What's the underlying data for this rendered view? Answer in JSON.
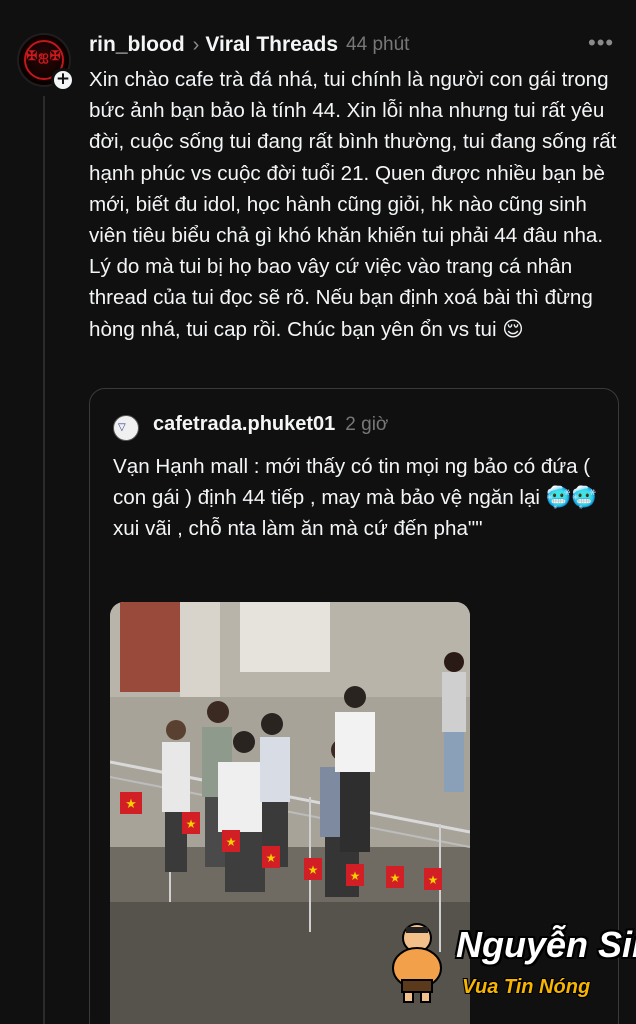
{
  "post": {
    "username": "rin_blood",
    "community": "Viral Threads",
    "time": "44 phút",
    "more_icon": "more-icon",
    "body": "Xin chào cafe trà đá nhá, tui chính là người con gái trong bức ảnh bạn bảo là tính 44. Xin lỗi nha nhưng tui rất yêu đời, cuộc sống tui đang rất bình thường, tui đang sống rất hạnh phúc vs cuộc đời tuổi 21. Quen được nhiều bạn bè mới, biết đu idol, học hành cũng giỏi, hk nào cũng sinh viên tiêu biểu chả gì khó khăn khiến tui phải 44 đâu nha. Lý do mà tui bị họ bao vây cứ việc vào trang cá nhân thread của tui đọc sẽ rõ. Nếu bạn định xoá bài thì đừng hòng nhá, tui cap rồi. Chúc bạn yên ổn vs tui 😌"
  },
  "quote": {
    "username": "cafetrada.phuket01",
    "time": "2 giờ",
    "body": "Vạn Hạnh mall : mới thấy có tin mọi ng bảo có đứa ( con gái ) định 44 tiếp , may mà bảo vệ ngăn lại 🥶🥶 xui vãi , chỗ nta làm ăn mà cứ đến pha\"\""
  },
  "watermark": {
    "name": "Nguyễn Sin",
    "tagline": "Vua Tin Nóng"
  },
  "colors": {
    "background": "#101010",
    "text": "#f3f5f7",
    "muted": "#777777",
    "border": "#3a3a3a",
    "flag_red": "#d21f26",
    "flag_star": "#f4d000",
    "watermark_yellow": "#f7b500"
  }
}
